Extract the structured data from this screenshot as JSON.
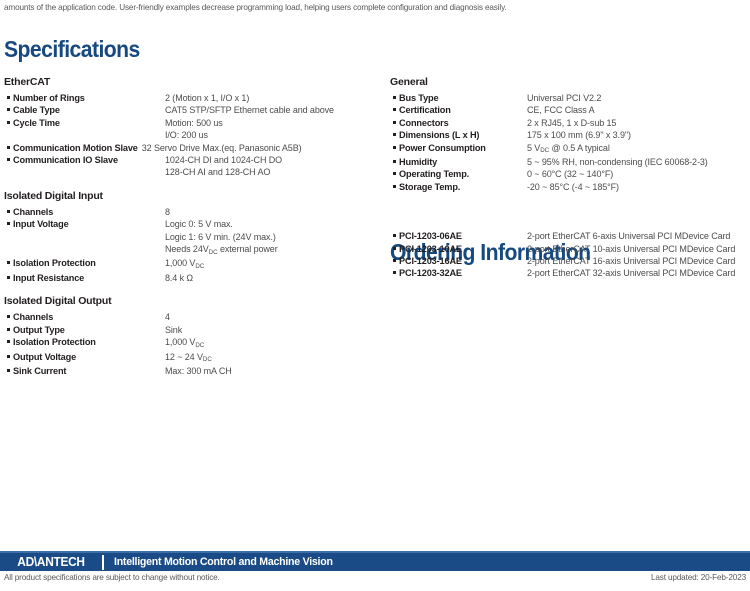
{
  "intro_paragraph": "amounts of the application code. User-friendly examples decrease programming load, helping users complete configuration and diagnosis easily.",
  "headings": {
    "specifications": "Specifications",
    "ordering_information": "Ordering Information"
  },
  "colors": {
    "heading_blue": "#15497f",
    "footer_blue": "#1b4b87",
    "footer_top_line": "#3d6ea7",
    "body_text": "#231f20",
    "value_text": "#4c4c4e"
  },
  "left_column": [
    {
      "title": "EtherCAT",
      "rows": [
        {
          "label": "Number of Rings",
          "value": "2 (Motion x 1, I/O x 1)"
        },
        {
          "label": "Cable Type",
          "value": "CAT5 STP/SFTP Ethernet cable and above"
        },
        {
          "label": "Cycle Time",
          "value": "Motion: 500 us\nI/O: 200 us"
        },
        {
          "label": "Communication Motion Slave",
          "value": "32 Servo Drive Max.(eq. Panasonic A5B)",
          "wide": true
        },
        {
          "label": "Communication IO Slave",
          "value": "1024-CH DI and 1024-CH DO\n128-CH AI and 128-CH AO"
        }
      ]
    },
    {
      "title": "Isolated Digital Input",
      "rows": [
        {
          "label": "Channels",
          "value": "8"
        },
        {
          "label": "Input Voltage",
          "value_html": "Logic 0: 5 V max.<br>Logic 1: 6 V min. (24V max.)<br>Needs 24V<sub>DC</sub> external power"
        },
        {
          "label": "Isolation Protection",
          "value_html": "1,000 V<sub>DC</sub>"
        },
        {
          "label": "Input Resistance",
          "value": "8.4 k Ω"
        }
      ]
    },
    {
      "title": "Isolated Digital Output",
      "rows": [
        {
          "label": "Channels",
          "value": "4"
        },
        {
          "label": "Output Type",
          "value": "Sink"
        },
        {
          "label": "Isolation Protection",
          "value_html": "1,000 V<sub>DC</sub>"
        },
        {
          "label": "Output Voltage",
          "value_html": "12 ~ 24 V<sub>DC</sub>"
        },
        {
          "label": "Sink Current",
          "value": "Max: 300 mA CH"
        }
      ]
    }
  ],
  "right_column": [
    {
      "title": "General",
      "rows": [
        {
          "label": "Bus Type",
          "value": "Universal PCI V2.2"
        },
        {
          "label": "Certification",
          "value": "CE, FCC Class A"
        },
        {
          "label": "Connectors",
          "value": "2 x RJ45, 1 x D-sub 15"
        },
        {
          "label": "Dimensions (L x H)",
          "value": "175 x 100 mm (6.9\" x 3.9\")"
        },
        {
          "label": "Power Consumption",
          "value_html": "5 V<sub>DC</sub> @ 0.5 A typical"
        },
        {
          "label": "Humidity",
          "value": "5 ~ 95% RH, non-condensing (IEC 60068-2-3)"
        },
        {
          "label": "Operating Temp.",
          "value": "0 ~ 60°C (32 ~ 140°F)"
        },
        {
          "label": "Storage Temp.",
          "value": "-20 ~ 85°C (-4 ~ 185°F)"
        }
      ]
    }
  ],
  "ordering_rows": [
    {
      "label": "PCI-1203-06AE",
      "value": "2-port EtherCAT 6-axis Universal PCI MDevice Card"
    },
    {
      "label": "PCI-1203-10AE",
      "value": "2-port EtherCAT 10-axis Universal PCI MDevice Card"
    },
    {
      "label": "PCI-1203-16AE",
      "value": "2-port EtherCAT 16-axis Universal PCI MDevice Card"
    },
    {
      "label": "PCI-1203-32AE",
      "value": "2-port EtherCAT 32-axis Universal PCI MDevice Card"
    }
  ],
  "footer": {
    "brand": "AD\\ANTECH",
    "tagline": "Intelligent Motion Control and Machine Vision",
    "disclaimer": "All product specifications are subject to change without notice.",
    "last_updated": "Last updated: 20-Feb-2023"
  }
}
